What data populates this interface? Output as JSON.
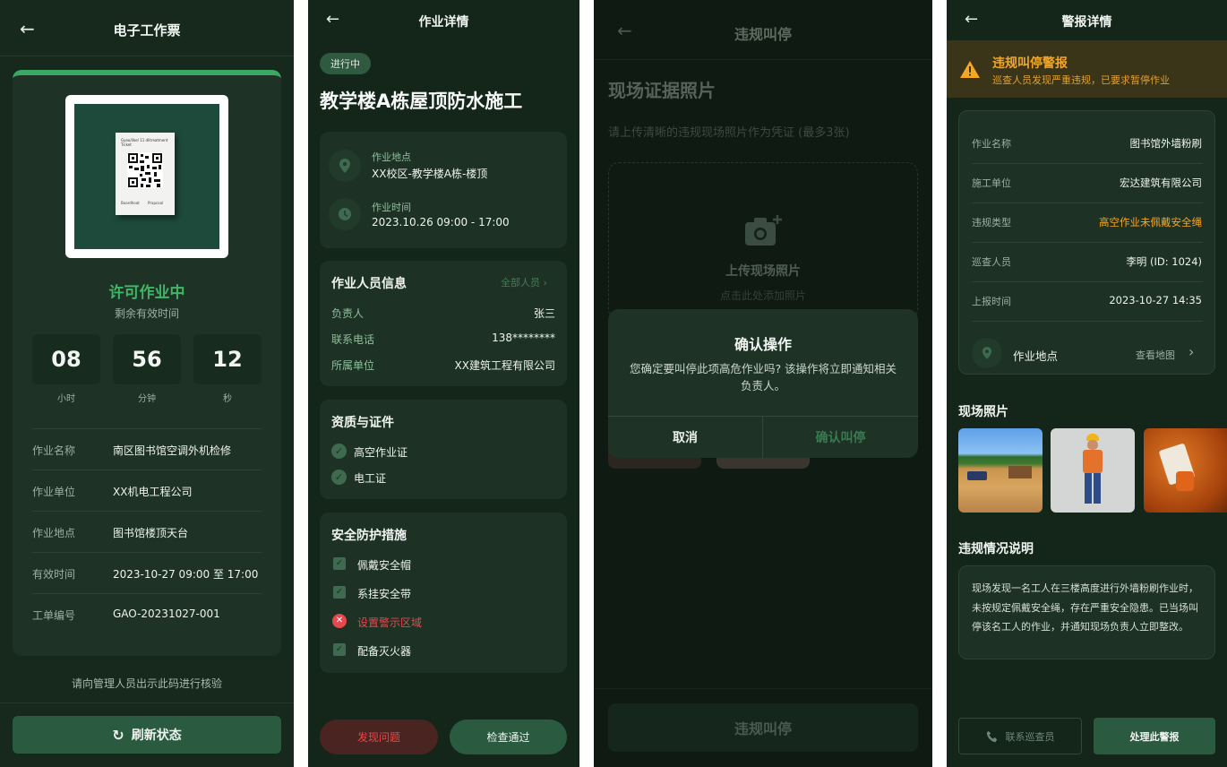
{
  "s1": {
    "title": "电子工作票",
    "qr_caption": "Gyeo/like/ 11 dlitreatment Ticket",
    "qr_footer_left": "Boardhoat",
    "qr_footer_right": "Prapcoal",
    "status": "许可作业中",
    "remaining_label": "剩余有效时间",
    "countdown": [
      {
        "value": "08",
        "unit": "小时"
      },
      {
        "value": "56",
        "unit": "分钟"
      },
      {
        "value": "12",
        "unit": "秒"
      }
    ],
    "rows": [
      {
        "label": "作业名称",
        "value": "南区图书馆空调外机检修"
      },
      {
        "label": "作业单位",
        "value": "XX机电工程公司"
      },
      {
        "label": "作业地点",
        "value": "图书馆楼顶天台"
      },
      {
        "label": "有效时间",
        "value": "2023-10-27 09:00 至 17:00"
      },
      {
        "label": "工单编号",
        "value": "GAO-20231027-001"
      }
    ],
    "hint": "请向管理人员出示此码进行核验",
    "refresh_label": "刷新状态"
  },
  "s2": {
    "title": "作业详情",
    "badge": "进行中",
    "heading": "教学楼A栋屋顶防水施工",
    "location_label": "作业地点",
    "location_value": "XX校区-教学楼A栋-楼顶",
    "time_label": "作业时间",
    "time_value": "2023.10.26 09:00 - 17:00",
    "personnel_title": "作业人员信息",
    "all_link": "全部人员",
    "personnel": [
      {
        "label": "负责人",
        "value": "张三"
      },
      {
        "label": "联系电话",
        "value": "138********"
      },
      {
        "label": "所属单位",
        "value": "XX建筑工程有限公司"
      }
    ],
    "certs_title": "资质与证件",
    "certs": [
      "高空作业证",
      "电工证"
    ],
    "safety_title": "安全防护措施",
    "safety": [
      {
        "label": "佩戴安全帽",
        "ok": true
      },
      {
        "label": "系挂安全带",
        "ok": true
      },
      {
        "label": "设置警示区域",
        "ok": false
      },
      {
        "label": "配备灭火器",
        "ok": true
      }
    ],
    "problem_btn": "发现问题",
    "pass_btn": "检查通过"
  },
  "s3": {
    "title": "违规叫停",
    "section_title": "现场证据照片",
    "instructions": "请上传清晰的违规现场照片作为凭证 (最多3张)",
    "upload_title": "上传现场照片",
    "upload_hint": "点击此处添加照片",
    "dialog_title": "确认操作",
    "dialog_body": "您确定要叫停此项高危作业吗? 该操作将立即通知相关负责人。",
    "cancel": "取消",
    "confirm": "确认叫停",
    "bottom_btn": "违规叫停"
  },
  "s4": {
    "title": "警报详情",
    "alert_title": "违规叫停警报",
    "alert_sub": "巡查人员发现严重违规，已要求暂停作业",
    "rows": [
      {
        "label": "作业名称",
        "value": "图书馆外墙粉刷",
        "highlight": false
      },
      {
        "label": "施工单位",
        "value": "宏达建筑有限公司",
        "highlight": false
      },
      {
        "label": "违规类型",
        "value": "高空作业未佩戴安全绳",
        "highlight": true
      },
      {
        "label": "巡查人员",
        "value": "李明 (ID: 1024)",
        "highlight": false
      },
      {
        "label": "上报时间",
        "value": "2023-10-27 14:35",
        "highlight": false
      }
    ],
    "location_label": "作业地点",
    "map_link": "查看地图",
    "photos_title": "现场照片",
    "desc_title": "违规情况说明",
    "desc": "现场发现一名工人在三楼高度进行外墙粉刷作业时，未按规定佩戴安全绳，存在严重安全隐患。已当场叫停该名工人的作业，并通知现场负责人立即整改。",
    "contact_btn": "联系巡查员",
    "handle_btn": "处理此警报"
  },
  "colors": {
    "accent_green": "#4fbf72",
    "alert_orange": "#f5a623",
    "danger_red": "#e5484d"
  }
}
